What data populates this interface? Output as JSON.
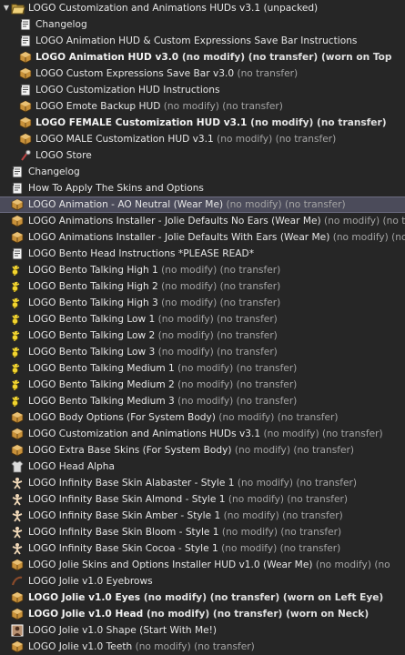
{
  "folder": {
    "label": "LOGO Customization and Animations HUDs v3.1 (unpacked)",
    "icon": "folder-open-icon"
  },
  "items": [
    {
      "d": 1,
      "icon": "notecard",
      "name": "Changelog",
      "suffix": "",
      "bold": false
    },
    {
      "d": 1,
      "icon": "notecard",
      "name": "LOGO Animation HUD & Custom Expressions Save Bar Instructions",
      "suffix": "",
      "bold": false
    },
    {
      "d": 1,
      "icon": "object",
      "name": "LOGO Animation HUD v3.0",
      "suffix": " (no modify) (no transfer) (worn on Top",
      "bold": true
    },
    {
      "d": 1,
      "icon": "object",
      "name": "LOGO Custom Expressions Save Bar v3.0",
      "suffix": " (no transfer)",
      "bold": false
    },
    {
      "d": 1,
      "icon": "notecard",
      "name": "LOGO Customization HUD Instructions",
      "suffix": "",
      "bold": false
    },
    {
      "d": 1,
      "icon": "object",
      "name": "LOGO Emote Backup HUD",
      "suffix": " (no modify) (no transfer)",
      "bold": false
    },
    {
      "d": 1,
      "icon": "object",
      "name": "LOGO FEMALE Customization HUD v3.1",
      "suffix": " (no modify) (no transfer)",
      "bold": true
    },
    {
      "d": 1,
      "icon": "object",
      "name": "LOGO MALE Customization HUD v3.1",
      "suffix": " (no modify) (no transfer)",
      "bold": false
    },
    {
      "d": 1,
      "icon": "landmark",
      "name": "LOGO Store",
      "suffix": "",
      "bold": false
    },
    {
      "d": 2,
      "icon": "notecard",
      "name": "Changelog",
      "suffix": "",
      "bold": false
    },
    {
      "d": 2,
      "icon": "notecard",
      "name": "How To Apply The Skins and Options",
      "suffix": "",
      "bold": false
    },
    {
      "d": 2,
      "icon": "object",
      "name": "LOGO Animation - AO Neutral (Wear Me)",
      "suffix": " (no modify) (no transfer)",
      "bold": false,
      "sel": true
    },
    {
      "d": 2,
      "icon": "object",
      "name": "LOGO Animations Installer - Jolie Defaults No Ears (Wear Me)",
      "suffix": " (no modify) (no transfer)",
      "bold": false
    },
    {
      "d": 2,
      "icon": "object",
      "name": "LOGO Animations Installer - Jolie Defaults With Ears (Wear Me)",
      "suffix": " (no modify) (no transfer)",
      "bold": false
    },
    {
      "d": 2,
      "icon": "notecard",
      "name": "LOGO Bento Head Instructions *PLEASE READ*",
      "suffix": "",
      "bold": false
    },
    {
      "d": 2,
      "icon": "gesture",
      "name": "LOGO Bento Talking High 1",
      "suffix": " (no modify) (no transfer)",
      "bold": false
    },
    {
      "d": 2,
      "icon": "gesture",
      "name": "LOGO Bento Talking High 2",
      "suffix": " (no modify) (no transfer)",
      "bold": false
    },
    {
      "d": 2,
      "icon": "gesture",
      "name": "LOGO Bento Talking High 3",
      "suffix": " (no modify) (no transfer)",
      "bold": false
    },
    {
      "d": 2,
      "icon": "gesture",
      "name": "LOGO Bento Talking Low 1",
      "suffix": " (no modify) (no transfer)",
      "bold": false
    },
    {
      "d": 2,
      "icon": "gesture",
      "name": "LOGO Bento Talking Low 2",
      "suffix": " (no modify) (no transfer)",
      "bold": false
    },
    {
      "d": 2,
      "icon": "gesture",
      "name": "LOGO Bento Talking Low 3",
      "suffix": " (no modify) (no transfer)",
      "bold": false
    },
    {
      "d": 2,
      "icon": "gesture",
      "name": "LOGO Bento Talking Medium 1",
      "suffix": " (no modify) (no transfer)",
      "bold": false
    },
    {
      "d": 2,
      "icon": "gesture",
      "name": "LOGO Bento Talking Medium 2",
      "suffix": " (no modify) (no transfer)",
      "bold": false
    },
    {
      "d": 2,
      "icon": "gesture",
      "name": "LOGO Bento Talking Medium 3",
      "suffix": " (no modify) (no transfer)",
      "bold": false
    },
    {
      "d": 2,
      "icon": "object",
      "name": "LOGO Body Options (For System Body)",
      "suffix": " (no modify) (no transfer)",
      "bold": false
    },
    {
      "d": 2,
      "icon": "object",
      "name": "LOGO Customization and Animations HUDs v3.1",
      "suffix": " (no modify) (no transfer)",
      "bold": false
    },
    {
      "d": 2,
      "icon": "object",
      "name": "LOGO Extra Base Skins (For System Body)",
      "suffix": " (no modify) (no transfer)",
      "bold": false
    },
    {
      "d": 2,
      "icon": "shirt",
      "name": "LOGO Head Alpha",
      "suffix": "",
      "bold": false
    },
    {
      "d": 2,
      "icon": "skin",
      "name": "LOGO Infinity Base Skin Alabaster - Style 1",
      "suffix": " (no modify) (no transfer)",
      "bold": false
    },
    {
      "d": 2,
      "icon": "skin",
      "name": "LOGO Infinity Base Skin Almond - Style 1",
      "suffix": " (no modify) (no transfer)",
      "bold": false
    },
    {
      "d": 2,
      "icon": "skin",
      "name": "LOGO Infinity Base Skin Amber - Style 1",
      "suffix": " (no modify) (no transfer)",
      "bold": false
    },
    {
      "d": 2,
      "icon": "skin",
      "name": "LOGO Infinity Base Skin Bloom - Style 1",
      "suffix": " (no modify) (no transfer)",
      "bold": false
    },
    {
      "d": 2,
      "icon": "skin",
      "name": "LOGO Infinity Base Skin Cocoa - Style 1",
      "suffix": " (no modify) (no transfer)",
      "bold": false
    },
    {
      "d": 2,
      "icon": "object",
      "name": "LOGO Jolie Skins and Options Installer HUD v1.0 (Wear Me)",
      "suffix": " (no modify) (no",
      "bold": false
    },
    {
      "d": 2,
      "icon": "eyebrow",
      "name": "LOGO Jolie v1.0 Eyebrows",
      "suffix": "",
      "bold": false
    },
    {
      "d": 2,
      "icon": "object",
      "name": "LOGO Jolie v1.0 Eyes",
      "suffix": " (no modify) (no transfer) (worn on Left Eye)",
      "bold": true
    },
    {
      "d": 2,
      "icon": "object",
      "name": "LOGO Jolie v1.0 Head",
      "suffix": " (no modify) (no transfer) (worn on Neck)",
      "bold": true
    },
    {
      "d": 2,
      "icon": "shape",
      "name": "LOGO Jolie v1.0 Shape (Start With Me!)",
      "suffix": "",
      "bold": false
    },
    {
      "d": 2,
      "icon": "object",
      "name": "LOGO Jolie v1.0 Teeth",
      "suffix": " (no modify) (no transfer)",
      "bold": false
    }
  ]
}
